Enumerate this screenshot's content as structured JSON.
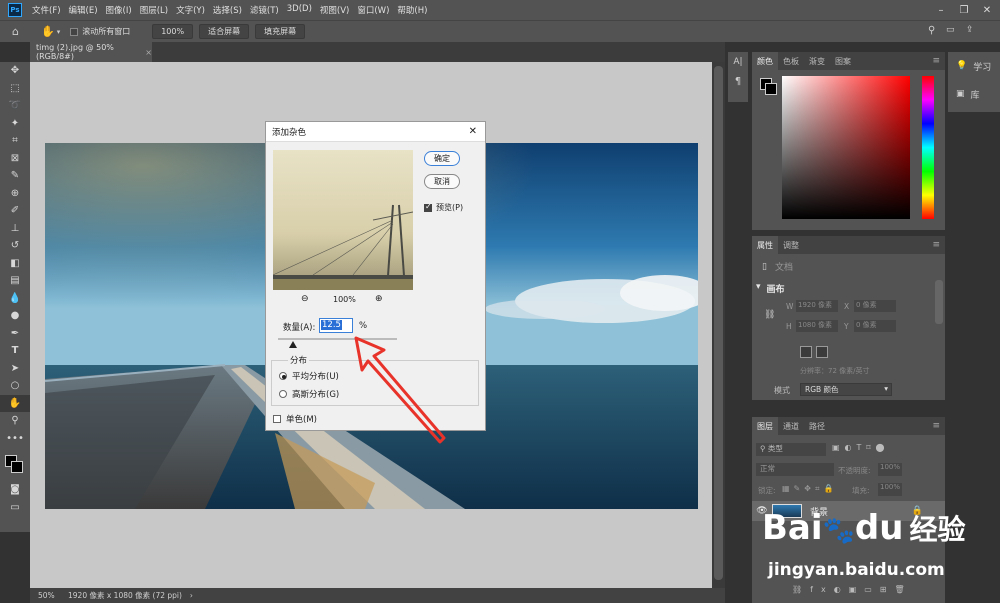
{
  "menu": {
    "logo": "Ps",
    "items": [
      "文件(F)",
      "编辑(E)",
      "图像(I)",
      "图层(L)",
      "文字(Y)",
      "选择(S)",
      "滤镜(T)",
      "3D(D)",
      "视图(V)",
      "窗口(W)",
      "帮助(H)"
    ]
  },
  "options": {
    "scroll_all": "滚动所有窗口",
    "zoom": "100%",
    "fit_screen": "适合屏幕",
    "fill_screen": "填充屏幕"
  },
  "document": {
    "tab_title": "timg (2).jpg @ 50%(RGB/8#)",
    "close": "×",
    "status_zoom": "50%",
    "status_info": "1920 像素 x 1080 像素 (72 ppi)",
    "status_arrow": "›"
  },
  "dialog": {
    "title": "添加杂色",
    "close": "✕",
    "ok": "确定",
    "cancel": "取消",
    "preview_label": "预览(P)",
    "zoom_level": "100%",
    "amount_label": "数量(A):",
    "amount_value": "12.5",
    "amount_unit": "%",
    "amount_fraction": 0.125,
    "distribution_label": "分布",
    "uniform_label": "平均分布(U)",
    "gaussian_label": "高斯分布(G)",
    "monochrome_label": "单色(M)"
  },
  "side_dock": {
    "char_icon": "A|",
    "para_icon": "¶"
  },
  "right_dock": {
    "learn": "学习",
    "library": "库"
  },
  "color_panel": {
    "tabs": [
      "颜色",
      "色板",
      "渐变",
      "图案"
    ]
  },
  "properties_panel": {
    "tabs": [
      "属性",
      "调整"
    ],
    "doc_label": "文档",
    "canvas_label": "画布",
    "w_label": "W",
    "w_value": "1920 像素",
    "h_label": "H",
    "h_value": "1080 像素",
    "x_label": "X",
    "x_value": "0 像素",
    "y_label": "Y",
    "y_value": "0 像素",
    "resolution": "分辨率：72 像素/英寸",
    "mode_label": "模式",
    "mode_value": "RGB 颜色"
  },
  "layers_panel": {
    "tabs": [
      "图层",
      "通道",
      "路径"
    ],
    "filter_kind": "类型",
    "blend_mode": "正常",
    "opacity_label": "不透明度:",
    "opacity_value": "100%",
    "lock_label": "锁定:",
    "fill_label": "填充:",
    "fill_value": "100%",
    "layer_name": "背景"
  },
  "watermark": {
    "brand": "Bai",
    "brand2": "du",
    "cn": "经验",
    "url": "jingyan.baidu.com"
  },
  "colors": {
    "accent": "#31a8ff",
    "arrow": "#e8332a"
  }
}
